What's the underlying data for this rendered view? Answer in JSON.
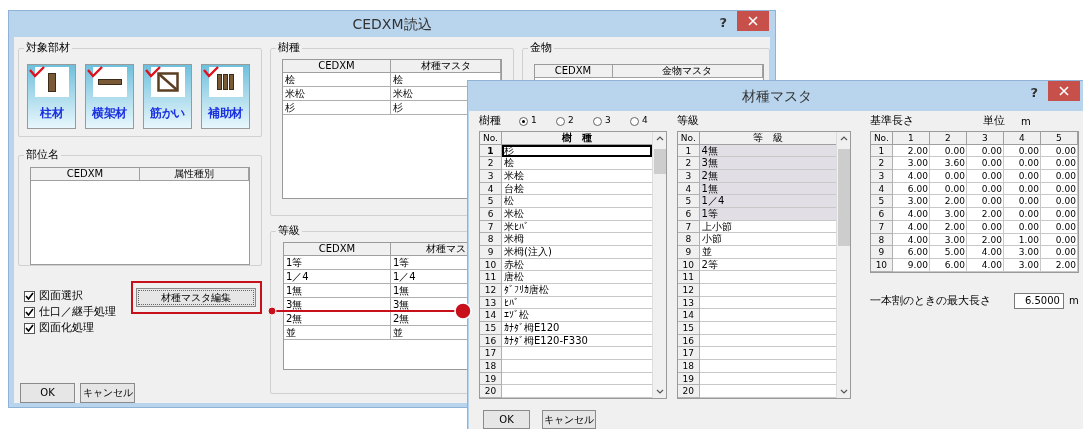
{
  "main_dialog": {
    "title": "CEDXM読込",
    "help": "?",
    "target_members": {
      "label": "対象部材",
      "items": [
        {
          "label": "柱材",
          "kind": "post",
          "checked": true
        },
        {
          "label": "横架材",
          "kind": "beam",
          "checked": true
        },
        {
          "label": "筋かい",
          "kind": "brace",
          "checked": true
        },
        {
          "label": "補助材",
          "kind": "auxiliary",
          "checked": true
        }
      ]
    },
    "part_names": {
      "label": "部位名",
      "columns": [
        "CEDXM",
        "属性種別"
      ]
    },
    "options": [
      {
        "label": "図面選択",
        "checked": true
      },
      {
        "label": "仕口／継手処理",
        "checked": true
      },
      {
        "label": "図面化処理",
        "checked": true
      }
    ],
    "edit_master_button": "材種マスタ編集",
    "buttons": [
      "OK",
      "キャンセル"
    ],
    "species": {
      "label": "樹種",
      "columns": [
        "CEDXM",
        "材種マスタ"
      ],
      "rows": [
        [
          "桧",
          "桧"
        ],
        [
          "米松",
          "米松"
        ],
        [
          "杉",
          "杉"
        ]
      ]
    },
    "grades": {
      "label": "等級",
      "columns": [
        "CEDXM",
        "材種マス"
      ],
      "rows": [
        [
          "1等",
          "1等"
        ],
        [
          "1／4",
          "1／4"
        ],
        [
          "1無",
          "1無"
        ],
        [
          "3無",
          "3無"
        ],
        [
          "2無",
          "2無"
        ],
        [
          "並",
          "並"
        ]
      ]
    },
    "hardware": {
      "label": "金物",
      "columns": [
        "CEDXM",
        "金物マスタ"
      ]
    }
  },
  "master_dialog": {
    "title": "材種マスタ",
    "help": "?",
    "species_label": "樹種",
    "sets": [
      {
        "label": "1",
        "selected": true
      },
      {
        "label": "2",
        "selected": false
      },
      {
        "label": "3",
        "selected": false
      },
      {
        "label": "4",
        "selected": false
      }
    ],
    "species_table": {
      "columns": [
        "No.",
        "樹　種"
      ],
      "rows": [
        {
          "no": "1",
          "name": "杉",
          "selected": true
        },
        {
          "no": "2",
          "name": "桧",
          "selected": false
        },
        {
          "no": "3",
          "name": "米桧",
          "selected": false
        },
        {
          "no": "4",
          "name": "台桧",
          "selected": false
        },
        {
          "no": "5",
          "name": "松",
          "selected": false
        },
        {
          "no": "6",
          "name": "米松",
          "selected": false
        },
        {
          "no": "7",
          "name": "米ﾋﾊﾞ",
          "selected": false
        },
        {
          "no": "8",
          "name": "米栂",
          "selected": false
        },
        {
          "no": "9",
          "name": "米栂(注入)",
          "selected": false
        },
        {
          "no": "10",
          "name": "赤松",
          "selected": false
        },
        {
          "no": "11",
          "name": "唐松",
          "selected": false
        },
        {
          "no": "12",
          "name": "ﾀﾞﾌﾘｶ唐松",
          "selected": false
        },
        {
          "no": "13",
          "name": "ﾋﾊﾞ",
          "selected": false
        },
        {
          "no": "14",
          "name": "ｴｿﾞ松",
          "selected": false
        },
        {
          "no": "15",
          "name": "ｶﾅﾀﾞ栂E120",
          "selected": false
        },
        {
          "no": "16",
          "name": "ｶﾅﾀﾞ栂E120-F330",
          "selected": false
        },
        {
          "no": "17",
          "selected": false
        },
        {
          "no": "18",
          "selected": false
        },
        {
          "no": "19",
          "selected": false
        },
        {
          "no": "20",
          "selected": false
        }
      ]
    },
    "grade_label": "等級",
    "grade_table": {
      "columns": [
        "No.",
        "等　級"
      ],
      "rows": [
        {
          "no": "1",
          "name": "4無",
          "highlighted": true
        },
        {
          "no": "2",
          "name": "3無",
          "highlighted": true
        },
        {
          "no": "3",
          "name": "2無",
          "highlighted": true
        },
        {
          "no": "4",
          "name": "1無",
          "highlighted": true
        },
        {
          "no": "5",
          "name": "1／4",
          "highlighted": true
        },
        {
          "no": "6",
          "name": "1等",
          "highlighted": true
        },
        {
          "no": "7",
          "name": "上小節",
          "highlighted": false
        },
        {
          "no": "8",
          "name": "小節",
          "highlighted": false
        },
        {
          "no": "9",
          "name": "並",
          "highlighted": false
        },
        {
          "no": "10",
          "name": "2等",
          "highlighted": false
        },
        {
          "no": "11",
          "highlighted": false
        },
        {
          "no": "12",
          "highlighted": false
        },
        {
          "no": "13",
          "highlighted": false
        },
        {
          "no": "14",
          "highlighted": false
        },
        {
          "no": "15",
          "highlighted": false
        },
        {
          "no": "16",
          "highlighted": false
        },
        {
          "no": "17",
          "highlighted": false
        },
        {
          "no": "18",
          "highlighted": false
        },
        {
          "no": "19",
          "highlighted": false
        },
        {
          "no": "20",
          "highlighted": false
        }
      ]
    },
    "length_label": "基準長さ",
    "unit_label": "単位",
    "unit": "m",
    "length_table": {
      "columns": [
        "No.",
        "1",
        "2",
        "3",
        "4",
        "5"
      ],
      "rows": [
        [
          "1",
          "2.00",
          "0.00",
          "0.00",
          "0.00",
          "0.00"
        ],
        [
          "2",
          "3.00",
          "3.60",
          "0.00",
          "0.00",
          "0.00"
        ],
        [
          "3",
          "4.00",
          "0.00",
          "0.00",
          "0.00",
          "0.00"
        ],
        [
          "4",
          "6.00",
          "0.00",
          "0.00",
          "0.00",
          "0.00"
        ],
        [
          "5",
          "3.00",
          "2.00",
          "0.00",
          "0.00",
          "0.00"
        ],
        [
          "6",
          "4.00",
          "3.00",
          "2.00",
          "0.00",
          "0.00"
        ],
        [
          "7",
          "4.00",
          "2.00",
          "0.00",
          "0.00",
          "0.00"
        ],
        [
          "8",
          "4.00",
          "3.00",
          "2.00",
          "1.00",
          "0.00"
        ],
        [
          "9",
          "6.00",
          "5.00",
          "4.00",
          "3.00",
          "0.00"
        ],
        [
          "10",
          "9.00",
          "6.00",
          "4.00",
          "3.00",
          "2.00"
        ]
      ]
    },
    "max_length": {
      "label": "一本割のときの最大長さ",
      "value": "6.5000",
      "unit": "m"
    },
    "buttons": [
      "OK",
      "キャンセル"
    ]
  }
}
